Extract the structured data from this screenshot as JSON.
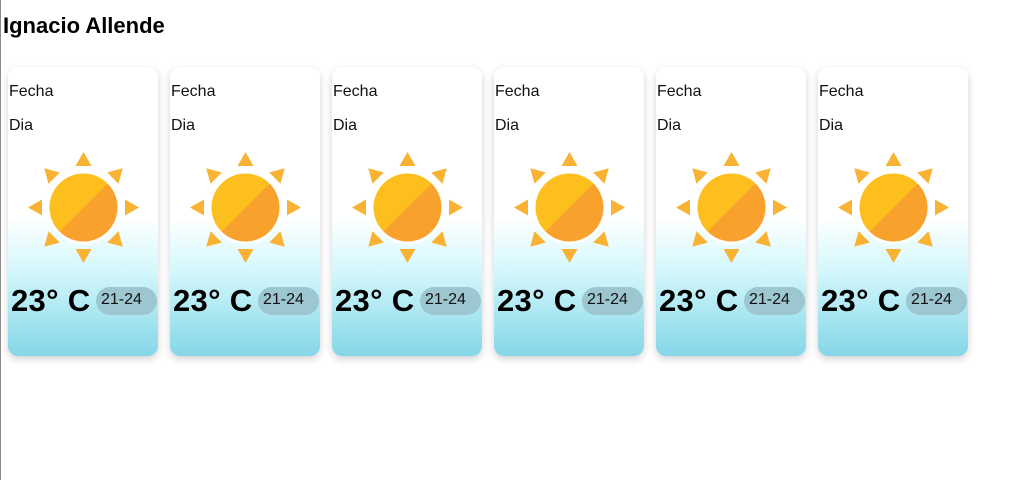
{
  "location": {
    "title": "Ignacio Allende"
  },
  "forecast": {
    "cards": [
      {
        "date_label": "Fecha",
        "day_label": "Dia",
        "icon": "sun-icon",
        "temp": "23° C",
        "range": "21-24"
      },
      {
        "date_label": "Fecha",
        "day_label": "Dia",
        "icon": "sun-icon",
        "temp": "23° C",
        "range": "21-24"
      },
      {
        "date_label": "Fecha",
        "day_label": "Dia",
        "icon": "sun-icon",
        "temp": "23° C",
        "range": "21-24"
      },
      {
        "date_label": "Fecha",
        "day_label": "Dia",
        "icon": "sun-icon",
        "temp": "23° C",
        "range": "21-24"
      },
      {
        "date_label": "Fecha",
        "day_label": "Dia",
        "icon": "sun-icon",
        "temp": "23° C",
        "range": "21-24"
      },
      {
        "date_label": "Fecha",
        "day_label": "Dia",
        "icon": "sun-icon",
        "temp": "23° C",
        "range": "21-24"
      }
    ]
  },
  "colors": {
    "sun_core_light": "#fcbf1e",
    "sun_core_dark": "#f8a12d",
    "sun_ray": "#f9b233",
    "range_pill": "#9cc6d0",
    "card_gradient_bottom": "#86d6e8"
  }
}
